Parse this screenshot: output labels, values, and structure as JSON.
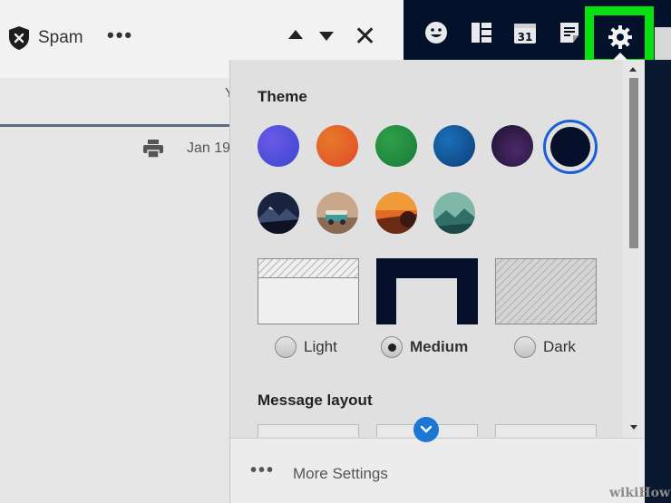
{
  "toolbar": {
    "spam_label": "Spam",
    "more_label": "•••"
  },
  "message": {
    "subbar_fragment": "Y",
    "date_fragment": "Jan 19"
  },
  "settings": {
    "theme_title": "Theme",
    "color_swatches": [
      "#4a4fd6",
      "#e3641f",
      "#22953a",
      "#1460a8",
      "#341c4a",
      "#06102a"
    ],
    "selected_swatch_index": 5,
    "photo_themes": [
      "mountain-night-icon",
      "camper-van-icon",
      "autumn-sunset-icon",
      "teal-mountains-icon"
    ],
    "brightness": {
      "options": [
        "Light",
        "Medium",
        "Dark"
      ],
      "selected": "Medium"
    },
    "layout_title": "Message layout",
    "more_settings_dots": "•••",
    "more_settings_label": "More Settings"
  },
  "colors": {
    "highlight_green": "#06e10f",
    "app_bar": "#03112a",
    "selection_ring": "#1a5ed8"
  },
  "watermark": "wikiHow"
}
